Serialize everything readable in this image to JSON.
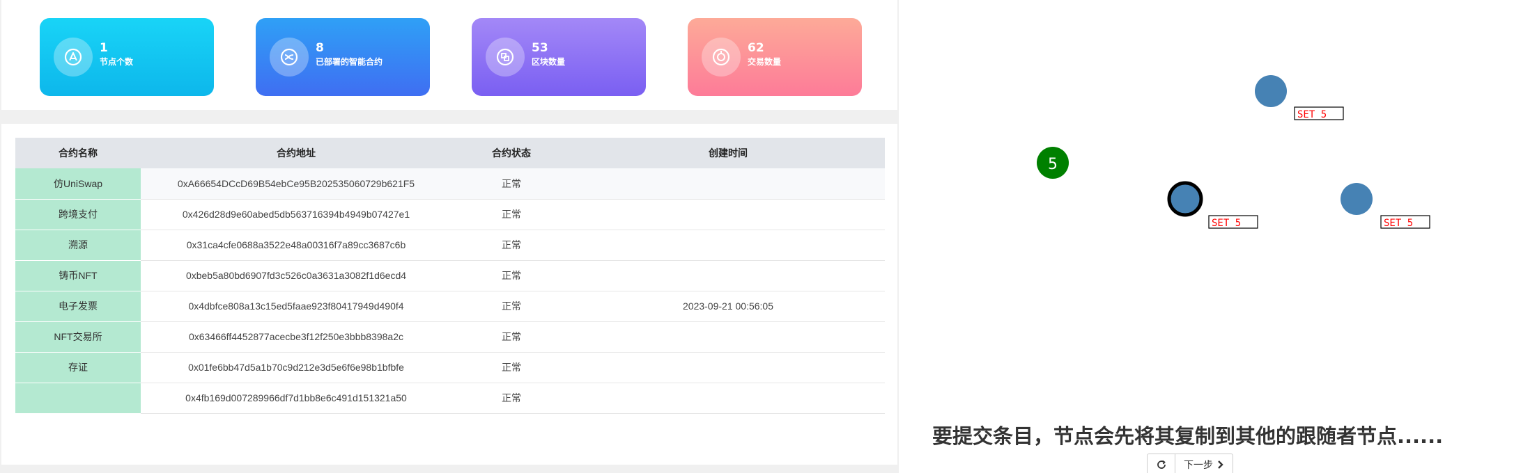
{
  "stats": [
    {
      "value": "1",
      "label": "节点个数",
      "icon": "nodes-icon"
    },
    {
      "value": "8",
      "label": "已部署的智能合约",
      "icon": "contract-icon"
    },
    {
      "value": "53",
      "label": "区块数量",
      "icon": "block-icon"
    },
    {
      "value": "62",
      "label": "交易数量",
      "icon": "transaction-icon"
    }
  ],
  "table": {
    "headers": [
      "合约名称",
      "合约地址",
      "合约状态",
      "创建时间"
    ],
    "rows": [
      {
        "name": "仿UniSwap",
        "address": "0xA66654DCcD69B54ebCe95B202535060729b621F5",
        "status": "正常",
        "time": ""
      },
      {
        "name": "跨境支付",
        "address": "0x426d28d9e60abed5db563716394b4949b07427e1",
        "status": "正常",
        "time": ""
      },
      {
        "name": "溯源",
        "address": "0x31ca4cfe0688a3522e48a00316f7a89cc3687c6b",
        "status": "正常",
        "time": ""
      },
      {
        "name": "铸币NFT",
        "address": "0xbeb5a80bd6907fd3c526c0a3631a3082f1d6ecd4",
        "status": "正常",
        "time": ""
      },
      {
        "name": "电子发票",
        "address": "0x4dbfce808a13c15ed5faae923f80417949d490f4",
        "status": "正常",
        "time": "2023-09-21 00:56:05"
      },
      {
        "name": "NFT交易所",
        "address": "0x63466ff4452877acecbe3f12f250e3bbb8398a2c",
        "status": "正常",
        "time": ""
      },
      {
        "name": "存证",
        "address": "0x01fe6bb47d5a1b70c9d212e3d5e6f6e98b1bfbfe",
        "status": "正常",
        "time": ""
      },
      {
        "name": "",
        "address": "0x4fb169d007289966df7d1bb8e6c491d151321a50",
        "status": "正常",
        "time": ""
      }
    ]
  },
  "raft": {
    "client_value": "5",
    "follower_label_1": "SET 5",
    "leader_label": "SET 5",
    "follower_label_2": "SET 5",
    "colors": {
      "node": "#4682b4",
      "client": "#008000",
      "label_text": "#ff0000"
    }
  },
  "caption": "要提交条目，节点会先将其复制到其他的跟随者节点......",
  "controls": {
    "reload_icon": "reload-icon",
    "next_label": "下一步",
    "next_icon": "chevron-right-icon"
  }
}
